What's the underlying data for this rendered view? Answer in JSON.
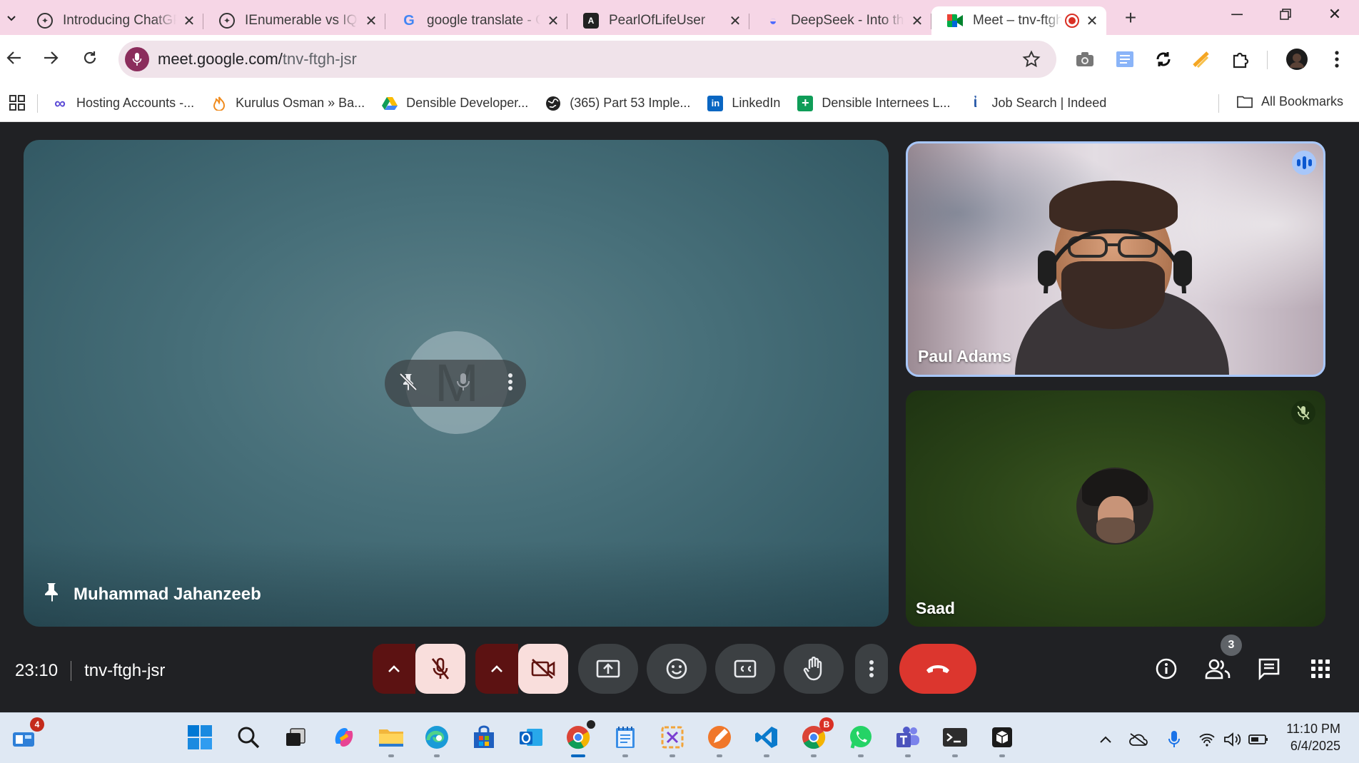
{
  "browser": {
    "tabs": [
      {
        "title": "Introducing ChatGPT",
        "icon": "openai-icon"
      },
      {
        "title": "IEnumerable vs IQueryable",
        "icon": "openai-icon"
      },
      {
        "title": "google translate - Google Search",
        "icon": "google-icon"
      },
      {
        "title": "PearlOfLifeUser",
        "icon": "angular-icon"
      },
      {
        "title": "DeepSeek - Into the Unknown",
        "icon": "deepseek-icon"
      },
      {
        "title": "Meet – tnv-ftgh-jsr",
        "icon": "meet-icon",
        "active": true,
        "recording": true
      }
    ],
    "url_host": "meet.google.com/",
    "url_path": "tnv-ftgh-jsr",
    "bookmarks": [
      {
        "label": "Hosting Accounts -...",
        "icon": "infinity-icon"
      },
      {
        "label": "Kurulus Osman » Ba...",
        "icon": "flame-icon"
      },
      {
        "label": "Densible Developer...",
        "icon": "drive-icon"
      },
      {
        "label": "(365) Part 53 Imple...",
        "icon": "globe-icon"
      },
      {
        "label": "LinkedIn",
        "icon": "linkedin-icon"
      },
      {
        "label": "Densible Internees L...",
        "icon": "sheets-icon"
      },
      {
        "label": "Job Search | Indeed",
        "icon": "indeed-icon"
      }
    ],
    "all_bookmarks": "All Bookmarks"
  },
  "meet": {
    "main_tile": {
      "name": "Muhammad Jahanzeeb",
      "initial": "M"
    },
    "tiles": [
      {
        "name": "Paul Adams",
        "speaking": true
      },
      {
        "name": "Saad",
        "muted": true
      }
    ],
    "time": "23:10",
    "meeting_code": "tnv-ftgh-jsr",
    "participant_count": "3"
  },
  "taskbar": {
    "widgets_badge": "4",
    "chrome2_badge": "B",
    "clock_time": "11:10 PM",
    "clock_date": "6/4/2025"
  },
  "colors": {
    "tab_strip": "#f6d6e6",
    "end_call": "#dc362e",
    "mic_off_bg": "#f9dedc",
    "speaking_border": "#a8c7fa"
  }
}
